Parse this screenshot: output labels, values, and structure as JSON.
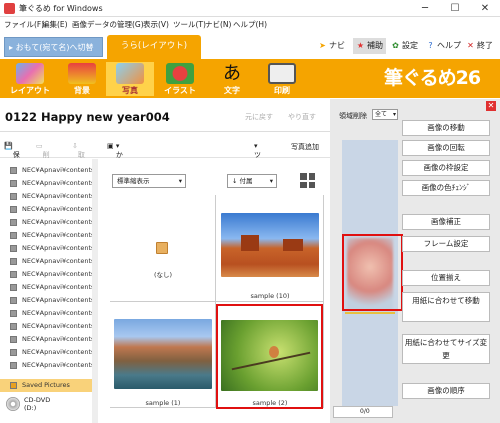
{
  "window": {
    "title": "筆ぐるめ for Windows",
    "controls": [
      "─",
      "☐",
      "✕"
    ]
  },
  "menu": [
    "ファイル(F)",
    "編集(E)",
    "画像データの管理(G)",
    "表示(V)",
    "ツール(T)",
    "ナビ(N)",
    "ヘルプ(H)"
  ],
  "tabs": {
    "front": "おもて(宛て名)へ切替",
    "back": "うら(レイアウト)"
  },
  "topbuttons": {
    "navi": "ナビ",
    "hosoku": "補助",
    "settei": "設定",
    "help": "ヘルプ",
    "exit": "終了"
  },
  "tools": [
    "レイアウト",
    "背景",
    "写真",
    "イラスト",
    "文字",
    "印刷"
  ],
  "logo": "筆ぐるめ26",
  "doc": {
    "title": "0122  Happy new year004",
    "undo": "元に戻す",
    "redo": "やり直す"
  },
  "cmd": {
    "save": "保存",
    "delete": "削除",
    "import": "取込",
    "easy_layout": "かんたんレイアウト",
    "tool": "ツール",
    "add_photo": "写真追加"
  },
  "folders": [
    "NEC¥Apnavi¥contents¥...",
    "NEC¥Apnavi¥contents¥...",
    "NEC¥Apnavi¥contents¥...",
    "NEC¥Apnavi¥contents¥...",
    "NEC¥Apnavi¥contents¥...",
    "NEC¥Apnavi¥contents¥...",
    "NEC¥Apnavi¥contents¥...",
    "NEC¥Apnavi¥contents¥...",
    "NEC¥Apnavi¥contents¥...",
    "NEC¥Apnavi¥contents¥...",
    "NEC¥Apnavi¥contents¥...",
    "NEC¥Apnavi¥contents¥...",
    "NEC¥Apnavi¥contents¥...",
    "NEC¥Apnavi¥contents¥...",
    "NEC¥Apnavi¥contents¥...",
    "NEC¥Apnavi¥contents¥...",
    "Saved Pictures"
  ],
  "drive": {
    "label": "CD-DVD",
    "sub": "(D:)"
  },
  "view": {
    "display": "標準縮表示",
    "sort": "付属"
  },
  "photos": [
    {
      "caption": "(なし)"
    },
    {
      "caption": "sample (10)"
    },
    {
      "caption": "sample (1)"
    },
    {
      "caption": "sample (2)"
    }
  ],
  "preview": {
    "area_delete": "領域削除",
    "scope": "全て",
    "page": "0/0"
  },
  "side_buttons": [
    "画像の移動",
    "画像の回転",
    "画像の枠設定",
    "画像の色ﾁｪﾝｼﾞ",
    "画像補正",
    "フレーム設定",
    "位置揃え",
    "用紙に合わせて移動",
    "用紙に合わせてサイズ変更",
    "画像の順序"
  ],
  "colors": {
    "accent": "#f5a400",
    "selection": "#e01010",
    "tab_front": "#8ab2dc"
  }
}
